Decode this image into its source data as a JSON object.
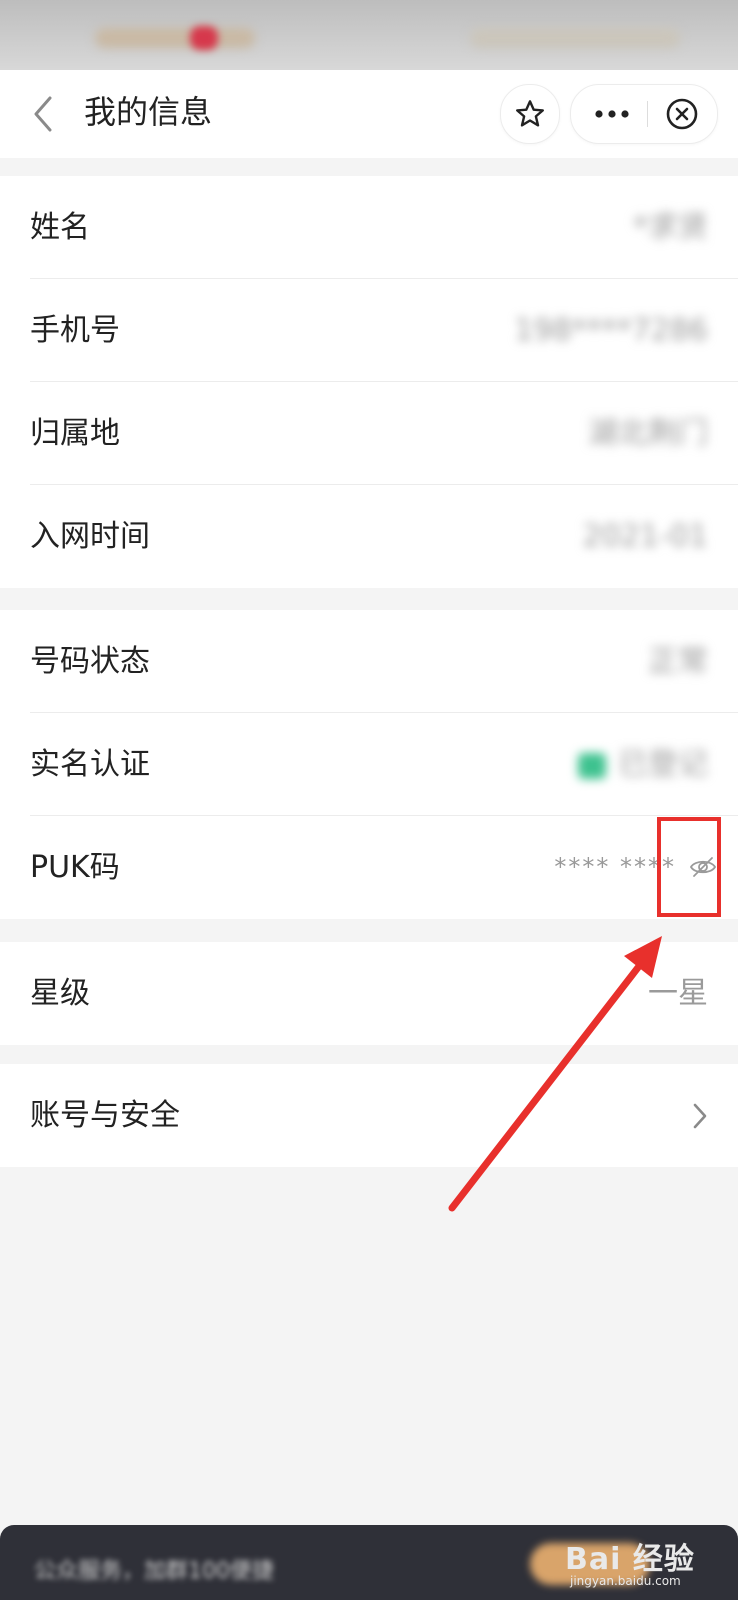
{
  "status_bar": {
    "left_text": "",
    "right_text": ""
  },
  "navbar": {
    "title": "我的信息",
    "back_icon": "chevron-left-icon",
    "star_icon": "star-icon",
    "more_icon": "more-dots-icon",
    "close_icon": "close-circle-icon"
  },
  "groups": [
    {
      "rows": [
        {
          "label": "姓名",
          "value": "*求贤"
        },
        {
          "label": "手机号",
          "value": "198****7286"
        },
        {
          "label": "归属地",
          "value": "湖北荆门"
        },
        {
          "label": "入网时间",
          "value": "2021-01"
        }
      ]
    },
    {
      "rows": [
        {
          "label": "号码状态",
          "value": "正常"
        },
        {
          "label": "实名认证",
          "value": "已登记"
        },
        {
          "label": "PUK码",
          "value": "**** ****",
          "icon": "eye-hidden-icon"
        }
      ]
    },
    {
      "rows": [
        {
          "label": "星级",
          "value": "一星"
        }
      ]
    },
    {
      "rows": [
        {
          "label": "账号与安全",
          "icon": "chevron-right-icon"
        }
      ]
    }
  ],
  "toast": {
    "text": "公众服务，加群100便捷",
    "button_label": ""
  },
  "watermark": {
    "brand": "Bai  经验",
    "url": "jingyan.baidu.com"
  },
  "colors": {
    "annotation_red": "#e8302c",
    "verified_green": "#3ec28f"
  }
}
